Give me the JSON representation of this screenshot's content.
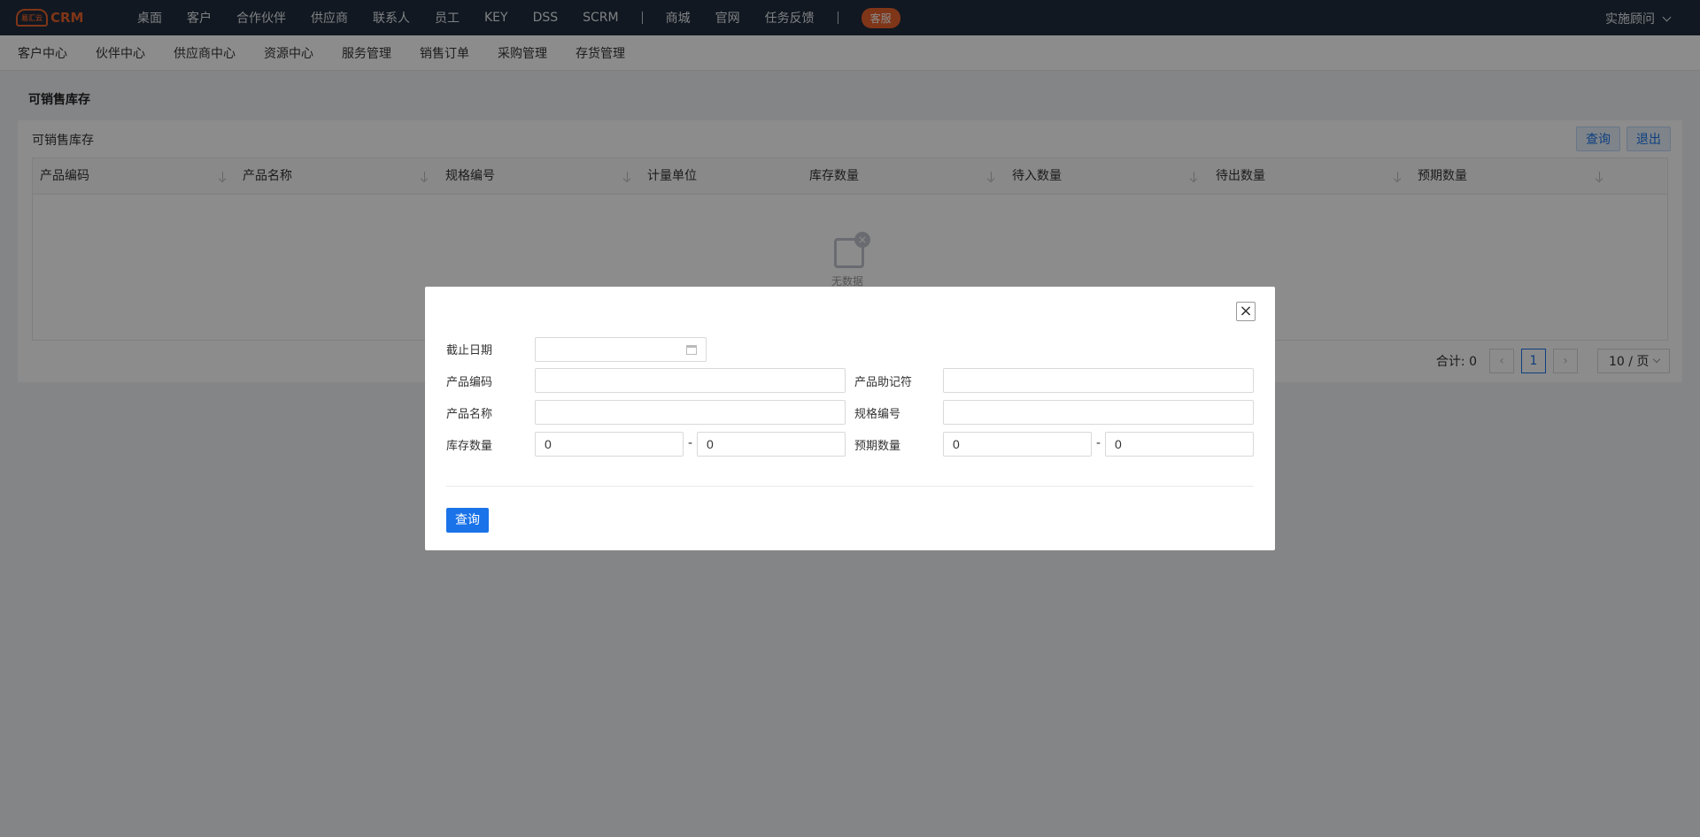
{
  "brand": {
    "logo_mark": "易汇云",
    "name": "CRM"
  },
  "top_nav": {
    "items": [
      "桌面",
      "客户",
      "合作伙伴",
      "供应商",
      "联系人",
      "员工",
      "KEY",
      "DSS",
      "SCRM"
    ],
    "items2": [
      "商城",
      "官网",
      "任务反馈"
    ],
    "service": "客服",
    "user": "实施顾问"
  },
  "sub_nav": [
    "客户中心",
    "伙伴中心",
    "供应商中心",
    "资源中心",
    "服务管理",
    "销售订单",
    "采购管理",
    "存货管理"
  ],
  "page": {
    "title": "可销售库存",
    "card_title": "可销售库存",
    "query_label": "查询",
    "exit_label": "退出"
  },
  "table": {
    "columns": [
      "产品编码",
      "产品名称",
      "规格编号",
      "计量单位",
      "库存数量",
      "待入数量",
      "待出数量",
      "预期数量"
    ],
    "empty_text": "无数据"
  },
  "pagination": {
    "total_label": "合计:",
    "total": "0",
    "prev": "‹",
    "current": "1",
    "next": "›",
    "page_size": "10 / 页"
  },
  "modal": {
    "close": "×",
    "cutoff_date_label": "截止日期",
    "cutoff_date_value": "",
    "product_code_label": "产品编码",
    "product_code_value": "",
    "product_mnemonic_label": "产品助记符",
    "product_mnemonic_value": "",
    "product_name_label": "产品名称",
    "product_name_value": "",
    "spec_code_label": "规格编号",
    "spec_code_value": "",
    "stock_qty_label": "库存数量",
    "stock_qty_min": "0",
    "stock_qty_max": "0",
    "expected_qty_label": "预期数量",
    "expected_qty_min": "0",
    "expected_qty_max": "0",
    "range_sep": "-",
    "query_label": "查询"
  }
}
